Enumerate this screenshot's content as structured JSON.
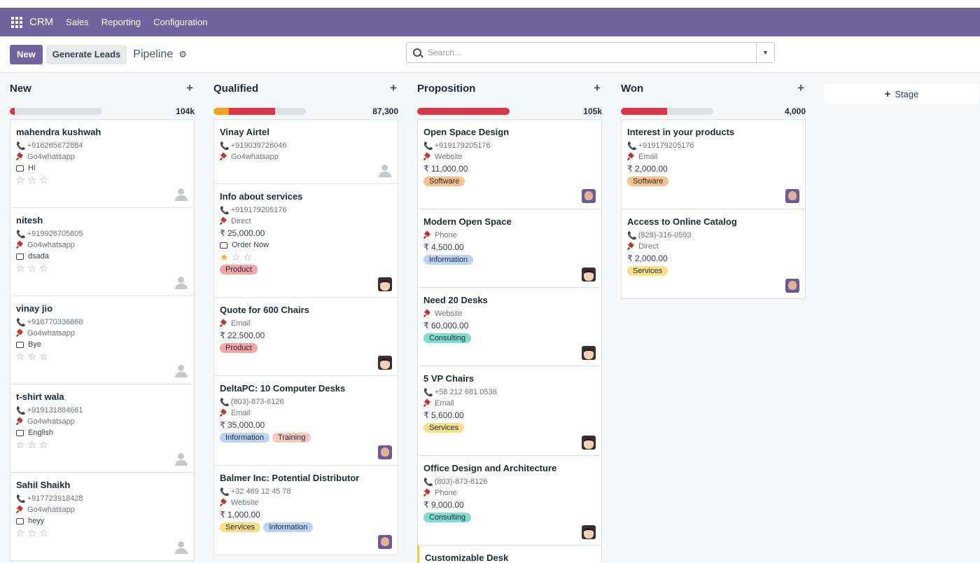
{
  "navbar": {
    "brand": "CRM",
    "items": [
      "Sales",
      "Reporting",
      "Configuration"
    ]
  },
  "control": {
    "new_label": "New",
    "generate_label": "Generate Leads",
    "breadcrumb": "Pipeline",
    "search_placeholder": "Search..."
  },
  "add_stage_label": "Stage",
  "columns": [
    {
      "title": "New",
      "total": "104k",
      "progress": [
        {
          "pct": 5,
          "color": "#dc3545"
        }
      ],
      "cards": [
        {
          "title": "mahendra kushwah",
          "phone": "+916265672884",
          "source": "Go4whatsapp",
          "message": "Hi",
          "stars": 0,
          "tags": [],
          "avatar": "ghost"
        },
        {
          "title": "nitesh",
          "phone": "+919926705805",
          "source": "Go4whatsapp",
          "message": "dsada",
          "stars": 0,
          "tags": [],
          "avatar": "ghost"
        },
        {
          "title": "vinay jio",
          "phone": "+918770336868",
          "source": "Go4whatsapp",
          "message": "Bye",
          "stars": 0,
          "tags": [],
          "avatar": "ghost"
        },
        {
          "title": "t-shirt wala",
          "phone": "+919131884661",
          "source": "Go4whatsapp",
          "message": "English",
          "stars": 0,
          "tags": [],
          "avatar": "ghost"
        },
        {
          "title": "Sahil Shaikh",
          "phone": "+917723918428",
          "source": "Go4whatsapp",
          "message": "heyy",
          "stars": 0,
          "tags": [],
          "avatar": "ghost"
        }
      ]
    },
    {
      "title": "Qualified",
      "total": "87,300",
      "progress": [
        {
          "pct": 17,
          "color": "#f3a21b"
        },
        {
          "pct": 50,
          "color": "#dc3545"
        }
      ],
      "cards": [
        {
          "title": "Vinay Airtel",
          "phone": "+919039726046",
          "source": "Go4whatsapp",
          "stars": null,
          "tags": [],
          "avatar": "ghost"
        },
        {
          "title": "Info about services",
          "phone": "+919179205176",
          "source": "Direct",
          "amount": "₹ 25,000.00",
          "message": "Order Now",
          "stars": 1,
          "tags": [
            {
              "label": "Product",
              "color": "#f5a3a3"
            }
          ],
          "avatar": "glasses"
        },
        {
          "title": "Quote for 600 Chairs",
          "source": "Email",
          "amount": "₹ 22,500.00",
          "stars": null,
          "tags": [
            {
              "label": "Product",
              "color": "#f5a3a3"
            }
          ],
          "avatar": "glasses"
        },
        {
          "title": "DeltaPC: 10 Computer Desks",
          "phone": "(803)-873-6126",
          "source": "Email",
          "amount": "₹ 35,000.00",
          "stars": null,
          "tags": [
            {
              "label": "Information",
              "color": "#b9d4f5"
            },
            {
              "label": "Training",
              "color": "#f6c9b8"
            }
          ],
          "avatar": "man"
        },
        {
          "title": "Balmer Inc: Potential Distributor",
          "phone": "+32 469 12 45 78",
          "source": "Website",
          "amount": "₹ 1,000.00",
          "stars": null,
          "tags": [
            {
              "label": "Services",
              "color": "#fbe08a"
            },
            {
              "label": "Information",
              "color": "#b9d4f5"
            }
          ],
          "avatar": "man"
        }
      ]
    },
    {
      "title": "Proposition",
      "total": "105k",
      "progress": [
        {
          "pct": 100,
          "color": "#dc3545"
        }
      ],
      "cards": [
        {
          "title": "Open Space Design",
          "phone": "+919179205176",
          "source": "Website",
          "amount": "₹ 11,000.00",
          "stars": null,
          "tags": [
            {
              "label": "Software",
              "color": "#f8c28c"
            }
          ],
          "avatar": "man"
        },
        {
          "title": "Modern Open Space",
          "source": "Phone",
          "amount": "₹ 4,500.00",
          "stars": null,
          "tags": [
            {
              "label": "Information",
              "color": "#b9d4f5"
            }
          ],
          "avatar": "glasses"
        },
        {
          "title": "Need 20 Desks",
          "source": "Website",
          "amount": "₹ 60,000.00",
          "stars": null,
          "tags": [
            {
              "label": "Consulting",
              "color": "#7fdcd0"
            }
          ],
          "avatar": "glasses"
        },
        {
          "title": "5 VP Chairs",
          "phone": "+58 212 681 0538",
          "source": "Email",
          "amount": "₹ 5,600.00",
          "stars": null,
          "tags": [
            {
              "label": "Services",
              "color": "#fbe08a"
            }
          ],
          "avatar": "glasses"
        },
        {
          "title": "Office Design and Architecture",
          "phone": "(803)-873-6126",
          "source": "Phone",
          "amount": "₹ 9,000.00",
          "stars": null,
          "tags": [
            {
              "label": "Consulting",
              "color": "#7fdcd0"
            }
          ],
          "avatar": "glasses"
        },
        {
          "title": "Customizable Desk",
          "stars": null,
          "tags": [],
          "avatar": "none",
          "highlight": true
        }
      ]
    },
    {
      "title": "Won",
      "total": "4,000",
      "progress": [
        {
          "pct": 50,
          "color": "#dc3545"
        }
      ],
      "cards": [
        {
          "title": "Interest in your products",
          "phone": "+919179205176",
          "source": "Email",
          "amount": "₹ 2,000.00",
          "stars": null,
          "tags": [
            {
              "label": "Software",
              "color": "#f8c28c"
            }
          ],
          "avatar": "man"
        },
        {
          "title": "Access to Online Catalog",
          "phone": "(828)-316-0593",
          "source": "Direct",
          "amount": "₹ 2,000.00",
          "stars": null,
          "tags": [
            {
              "label": "Services",
              "color": "#fbe08a"
            }
          ],
          "avatar": "man"
        }
      ]
    }
  ]
}
